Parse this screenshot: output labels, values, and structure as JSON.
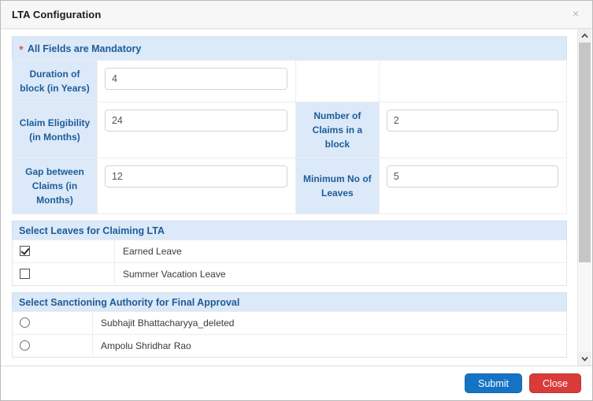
{
  "window": {
    "title": "LTA Configuration",
    "close_icon": "close-icon",
    "close_glyph": "×"
  },
  "mandatory_notice": {
    "star": "*",
    "text": "All Fields are Mandatory"
  },
  "form": {
    "rows": [
      {
        "left_label": "Duration of block (in Years)",
        "left_value": "4",
        "left_placeholder": "",
        "right_label": "",
        "right_value": "",
        "right_placeholder": ""
      },
      {
        "left_label": "Claim Eligibility (in Months)",
        "left_value": "24",
        "left_placeholder": "",
        "right_label": "Number of Claims in a block",
        "right_value": "2",
        "right_placeholder": ""
      },
      {
        "left_label": "Gap between Claims (in Months)",
        "left_value": "12",
        "left_placeholder": "",
        "right_label": "Minimum No of Leaves",
        "right_value": "5",
        "right_placeholder": ""
      }
    ]
  },
  "leaves_section": {
    "header": "Select Leaves for Claiming LTA",
    "items": [
      {
        "label": "Earned Leave",
        "checked": true
      },
      {
        "label": "Summer Vacation Leave",
        "checked": false
      }
    ]
  },
  "authority_section": {
    "header": "Select Sanctioning Authority for Final Approval",
    "items": [
      {
        "label": "Subhajit Bhattacharyya_deleted",
        "selected": false
      },
      {
        "label": "Ampolu Shridhar Rao",
        "selected": false
      }
    ]
  },
  "scrollbar": {
    "up_icon": "chevron-up-icon",
    "down_icon": "chevron-down-icon",
    "thumb_position_percent": 0
  },
  "footer": {
    "submit_label": "Submit",
    "close_label": "Close"
  },
  "colors": {
    "accent_blue": "#1f5c99",
    "header_bg": "#dbe9f8",
    "submit": "#1573c4",
    "close": "#d93b3b",
    "required_star": "#e8252a"
  }
}
